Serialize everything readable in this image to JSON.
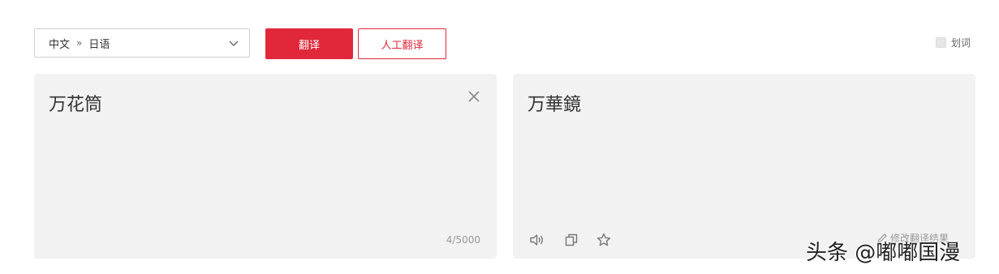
{
  "toolbar": {
    "source_lang": "中文",
    "separator": "»",
    "target_lang": "日语",
    "translate_label": "翻译",
    "human_translate_label": "人工翻译",
    "word_pick_label": "划词"
  },
  "source_panel": {
    "text": "万花筒",
    "counter": "4/5000"
  },
  "target_panel": {
    "text": "万華鏡",
    "edit_label": "修改翻译结果"
  },
  "icons": [
    "chevron-down-icon",
    "close-icon",
    "speaker-icon",
    "copy-icon",
    "star-icon",
    "pencil-icon"
  ],
  "colors": {
    "accent": "#e1283a",
    "panel_bg": "#f2f2f2"
  },
  "watermark": "头条 @嘟嘟国漫"
}
